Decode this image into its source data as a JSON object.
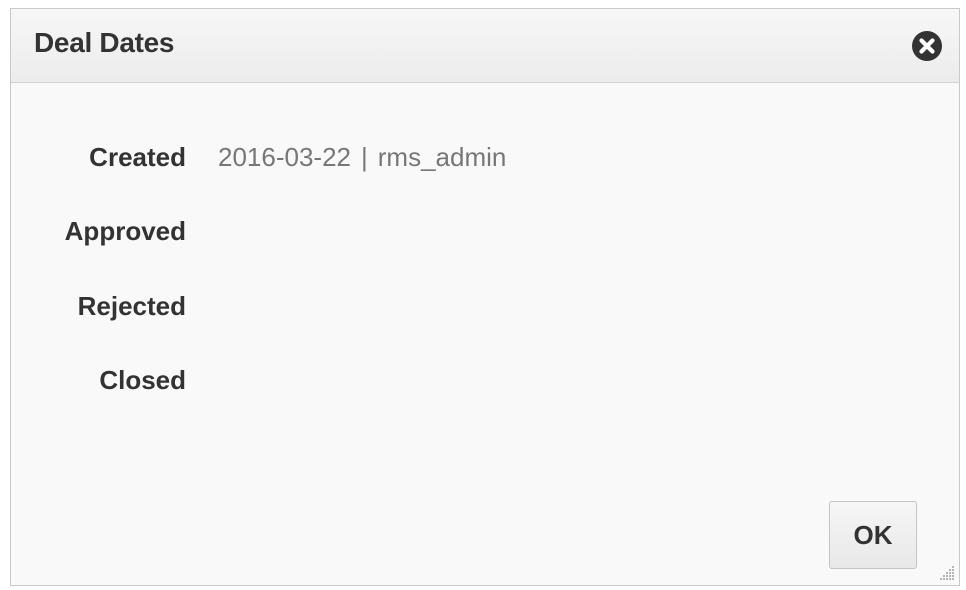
{
  "dialog": {
    "title": "Deal Dates",
    "close_icon": "close-circle-icon",
    "fields": [
      {
        "label": "Created",
        "date": "2016-03-22",
        "separator": "|",
        "user": "rms_admin"
      },
      {
        "label": "Approved"
      },
      {
        "label": "Rejected"
      },
      {
        "label": "Closed"
      }
    ],
    "ok_label": "OK",
    "resize_icon": "resize-grip-icon"
  },
  "colors": {
    "title_text": "#333333",
    "value_text": "#777777",
    "dialog_bg": "#f9f9f9",
    "header_bg": "#ececec",
    "close_icon": "#333333"
  }
}
